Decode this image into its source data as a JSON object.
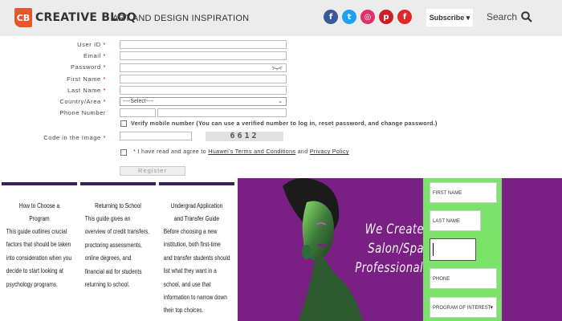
{
  "header": {
    "logo_mark": "CB",
    "logo_text": "CREATIVE BLOQ",
    "tagline": "ART AND DESIGN INSPIRATION",
    "socials": [
      {
        "name": "facebook",
        "glyph": "f",
        "color": "#3b5998"
      },
      {
        "name": "twitter",
        "glyph": "t",
        "color": "#1da1f2"
      },
      {
        "name": "instagram",
        "glyph": "◎",
        "color": "#e1306c"
      },
      {
        "name": "pinterest",
        "glyph": "p",
        "color": "#cb2027"
      },
      {
        "name": "flipboard",
        "glyph": "f",
        "color": "#e12828"
      }
    ],
    "subscribe_label": "Subscribe ▾",
    "search_label": "Search"
  },
  "form": {
    "user_id_label": "User ID",
    "email_label": "Email",
    "password_label": "Password",
    "first_name_label": "First Name",
    "last_name_label": "Last Name",
    "country_label": "Country/Area",
    "country_value": "----Select----",
    "phone_label": "Phone Number",
    "verify_text": "Verify mobile number (You can use a verified number to log in, reset password, and change password.)",
    "code_label": "Code in the Image",
    "captcha_text": "6612",
    "agree_prefix": "I have read and agree to",
    "terms_link": "Huawei's Terms and Conditions",
    "agree_and": "and",
    "privacy_link": "Privacy Policy",
    "register_label": "Register",
    "required_mark": "*"
  },
  "guides": [
    {
      "title": "How to Choose a Program",
      "body": "This guide outlines crucial factors that should be taken into consideration when you decide to start looking at psychology programs."
    },
    {
      "title": "Returning to School",
      "body": "This guide gives an overview of credit transfers, proctoring assessments, online degrees, and financial aid for students returning to school."
    },
    {
      "title": "Undergrad Application and Transfer Guide",
      "body": "Before choosing a new institution, both first-time and transfer students should list what they want in a school, and use that information to narrow down their top choices."
    }
  ],
  "banner": {
    "headline_1": "We Create",
    "headline_2": "Salon/Spa",
    "headline_3": "Professionals",
    "first_name_placeholder": "FIRST NAME",
    "last_name_placeholder": "LAST NAME",
    "phone_placeholder": "PHONE",
    "program_value": "PROGRAM OF INTEREST"
  },
  "colors": {
    "banner_purple": "#7a1f84",
    "form_green": "#7be26a",
    "logo_orange": "#e8572b",
    "card_accent": "#3d1f5e"
  }
}
